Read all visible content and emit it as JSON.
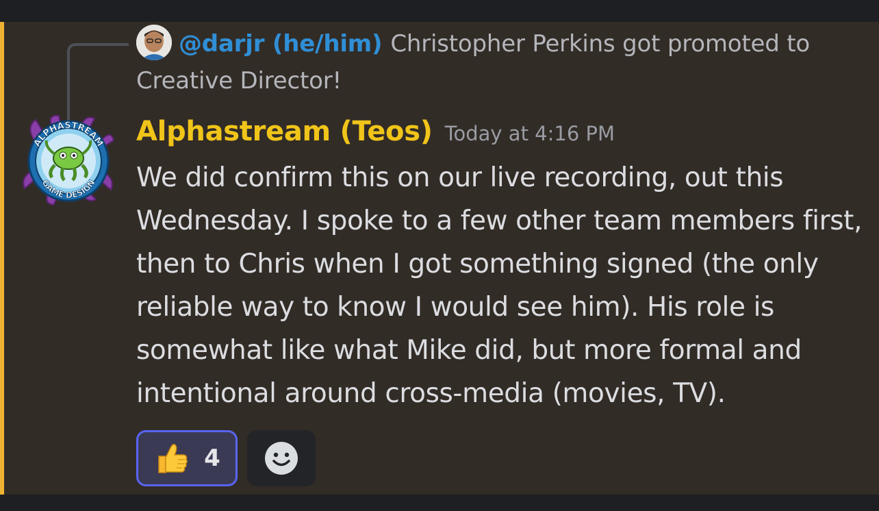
{
  "reply": {
    "author": "@darjr (he/him)",
    "text": "Christopher Perkins got promoted to Creative Director!"
  },
  "message": {
    "author": "Alphastream (Teos)",
    "timestamp": "Today at 4:16 PM",
    "content": "We did confirm this on our live recording, out this Wednesday. I spoke to a few other team members first, then to Chris when I got something signed (the only reliable way to know I would see him). His role is somewhat like what Mike did, but more formal and intentional around cross-media (movies, TV).",
    "avatar_logo_text": [
      "ALPHASTREAM",
      "GAME DESIGN"
    ]
  },
  "reactions": [
    {
      "emoji": "thumbs-up-icon",
      "count": "4",
      "selected": true
    }
  ],
  "add_reaction": {
    "icon": "add-reaction-smiley-icon"
  },
  "colors": {
    "author": "#f0c419",
    "reply_author": "#2f8fd6",
    "highlight_bar": "#f0b232",
    "reaction_border": "#5865f2"
  }
}
